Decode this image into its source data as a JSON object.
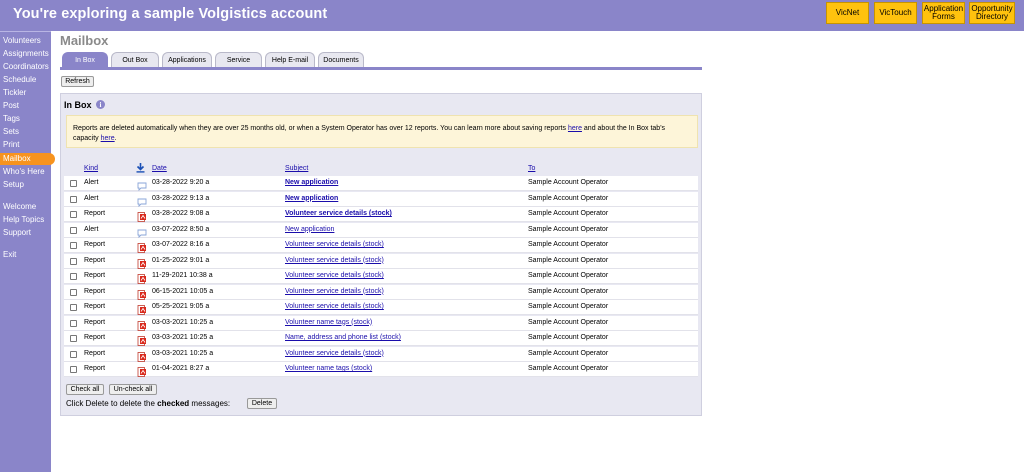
{
  "header": {
    "title": "You're exploring a sample Volgistics account",
    "buttons": [
      {
        "label": "VicNet"
      },
      {
        "label": "VicTouch"
      },
      {
        "label1": "Application",
        "label2": "Forms"
      },
      {
        "label1": "Opportunity",
        "label2": "Directory"
      }
    ]
  },
  "sidebar": {
    "items": [
      {
        "label": "Volunteers"
      },
      {
        "label": "Assignments"
      },
      {
        "label": "Coordinators"
      },
      {
        "label": "Schedule"
      },
      {
        "label": "Tickler"
      },
      {
        "label": "Post"
      },
      {
        "label": "Tags"
      },
      {
        "label": "Sets"
      },
      {
        "label": "Print"
      },
      {
        "label": "Mailbox"
      },
      {
        "label": "Who's Here"
      },
      {
        "label": "Setup"
      },
      {
        "label": "Welcome"
      },
      {
        "label": "Help Topics"
      },
      {
        "label": "Support"
      },
      {
        "label": "Exit"
      }
    ],
    "active_index": 9
  },
  "page": {
    "title": "Mailbox",
    "tabs": [
      {
        "label": "In Box"
      },
      {
        "label": "Out Box"
      },
      {
        "label": "Applications"
      },
      {
        "label": "Service"
      },
      {
        "label": "Help E-mail"
      },
      {
        "label": "Documents"
      }
    ],
    "active_tab": 0,
    "refresh_label": "Refresh"
  },
  "inbox": {
    "title": "In Box",
    "info_icon": "i",
    "notice": {
      "part1": "Reports are deleted automatically when they are over 25 months old, or when a System Operator has over 12 reports. You can learn more about saving reports ",
      "link1": "here",
      "part2": " and about the In Box tab's capacity ",
      "link2": "here",
      "part3": "."
    },
    "columns": {
      "kind": "Kind",
      "date": "Date",
      "subject": "Subject",
      "to": "To"
    },
    "rows": [
      {
        "kind": "Alert",
        "icon": "message-icon",
        "date": "03-28-2022 9:20 a",
        "subject": "New application",
        "bold": true,
        "to": "Sample Account Operator"
      },
      {
        "kind": "Alert",
        "icon": "message-icon",
        "date": "03-28-2022 9:13 a",
        "subject": "New application",
        "bold": true,
        "to": "Sample Account Operator"
      },
      {
        "kind": "Report",
        "icon": "pdf-icon",
        "date": "03-28-2022 9:08 a",
        "subject": "Volunteer service details (stock)",
        "bold": true,
        "to": "Sample Account Operator"
      },
      {
        "kind": "Alert",
        "icon": "message-icon",
        "date": "03-07-2022 8:50 a",
        "subject": "New application",
        "bold": false,
        "to": "Sample Account Operator"
      },
      {
        "kind": "Report",
        "icon": "pdf-icon",
        "date": "03-07-2022 8:16 a",
        "subject": "Volunteer service details (stock)",
        "bold": false,
        "to": "Sample Account Operator"
      },
      {
        "kind": "Report",
        "icon": "pdf-icon",
        "date": "01-25-2022 9:01 a",
        "subject": "Volunteer service details (stock)",
        "bold": false,
        "to": "Sample Account Operator"
      },
      {
        "kind": "Report",
        "icon": "pdf-icon",
        "date": "11-29-2021 10:38 a",
        "subject": "Volunteer service details (stock)",
        "bold": false,
        "to": "Sample Account Operator"
      },
      {
        "kind": "Report",
        "icon": "pdf-icon",
        "date": "06-15-2021 10:05 a",
        "subject": "Volunteer service details (stock)",
        "bold": false,
        "to": "Sample Account Operator"
      },
      {
        "kind": "Report",
        "icon": "pdf-icon",
        "date": "05-25-2021 9:05 a",
        "subject": "Volunteer service details (stock)",
        "bold": false,
        "to": "Sample Account Operator"
      },
      {
        "kind": "Report",
        "icon": "pdf-icon",
        "date": "03-03-2021 10:25 a",
        "subject": "Volunteer name tags (stock)",
        "bold": false,
        "to": "Sample Account Operator"
      },
      {
        "kind": "Report",
        "icon": "pdf-icon",
        "date": "03-03-2021 10:25 a",
        "subject": "Name, address and phone list (stock)",
        "bold": false,
        "to": "Sample Account Operator"
      },
      {
        "kind": "Report",
        "icon": "pdf-icon",
        "date": "03-03-2021 10:25 a",
        "subject": "Volunteer service details (stock)",
        "bold": false,
        "to": "Sample Account Operator"
      },
      {
        "kind": "Report",
        "icon": "pdf-icon",
        "date": "01-04-2021 8:27 a",
        "subject": "Volunteer name tags (stock)",
        "bold": false,
        "to": "Sample Account Operator"
      }
    ],
    "check_all": "Check all",
    "uncheck_all": "Un-check all",
    "delete_prefix": "Click Delete to delete the ",
    "delete_checked": "checked",
    "delete_suffix": " messages:",
    "delete_label": "Delete"
  },
  "colors": {
    "brand": "#8a85c9",
    "accent": "#ffc20e",
    "active": "#f7931e",
    "link": "#1a0dab"
  }
}
